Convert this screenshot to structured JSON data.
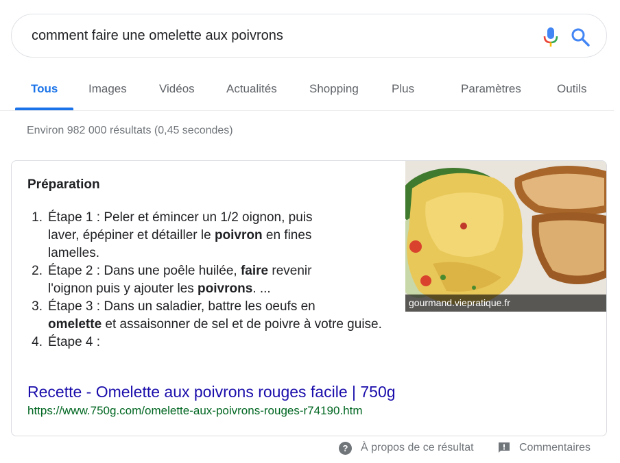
{
  "search": {
    "query": "comment faire une omelette aux poivrons"
  },
  "tabs": [
    {
      "label": "Tous"
    },
    {
      "label": "Images"
    },
    {
      "label": "Vidéos"
    },
    {
      "label": "Actualités"
    },
    {
      "label": "Shopping"
    },
    {
      "label": "Plus"
    },
    {
      "label": "Paramètres"
    },
    {
      "label": "Outils"
    }
  ],
  "stats": "Environ 982 000 résultats (0,45 secondes)",
  "snippet": {
    "heading": "Préparation",
    "steps": [
      {
        "num": "1.",
        "parts": [
          "Étape 1 : Peler et émincer un 1/2 oignon, puis",
          "laver, épépiner et détailler le ",
          "poivron",
          " en fines",
          "lamelles."
        ]
      },
      {
        "num": "2.",
        "parts": [
          "Étape 2 : Dans une poêle huilée, ",
          "faire",
          " revenir",
          "l'oignon puis y ajouter les ",
          "poivrons",
          ". ..."
        ]
      },
      {
        "num": "3.",
        "parts": [
          "Étape 3 : Dans un saladier, battre les oeufs en",
          "omelette",
          " et assaisonner de sel et de poivre à votre guise."
        ]
      },
      {
        "num": "4.",
        "parts": [
          "Étape 4 :"
        ]
      }
    ],
    "image_caption": "gourmand.viepratique.fr",
    "result_title": "Recette - Omelette aux poivrons rouges facile | 750g",
    "result_url": "https://www.750g.com/omelette-aux-poivrons-rouges-r74190.htm"
  },
  "footer": {
    "about": "À propos de ce résultat",
    "feedback": "Commentaires"
  },
  "colors": {
    "accent": "#1a73e8",
    "link": "#1a0dab",
    "url": "#006621"
  }
}
